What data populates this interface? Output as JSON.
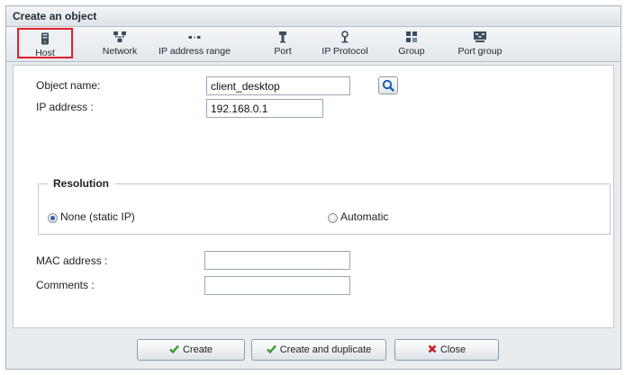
{
  "dialog": {
    "title": "Create an object"
  },
  "toolbar": {
    "items": [
      {
        "label": "Host",
        "icon": "host-icon",
        "selected": true
      },
      {
        "label": "Network",
        "icon": "network-icon"
      },
      {
        "label": "IP address range",
        "icon": "ip-range-icon"
      },
      {
        "label": "Port",
        "icon": "port-icon"
      },
      {
        "label": "IP Protocol",
        "icon": "ip-protocol-icon"
      },
      {
        "label": "Group",
        "icon": "group-icon"
      },
      {
        "label": "Port group",
        "icon": "port-group-icon"
      }
    ]
  },
  "form": {
    "object_name": {
      "label": "Object name:",
      "value": "client_desktop"
    },
    "ip_address": {
      "label": "IP address :",
      "value": "192.168.0.1"
    },
    "resolution": {
      "legend": "Resolution",
      "options": [
        {
          "label": "None (static IP)",
          "checked": true
        },
        {
          "label": "Automatic",
          "checked": false
        }
      ]
    },
    "mac_address": {
      "label": "MAC address :",
      "value": ""
    },
    "comments": {
      "label": "Comments :",
      "value": ""
    }
  },
  "footer": {
    "create_label": "Create",
    "create_dup_label": "Create and duplicate",
    "close_label": "Close"
  },
  "colors": {
    "selected_border": "#e0202a",
    "check_green": "#3a9a2a",
    "close_red": "#cc1d1d",
    "radio_dot": "#2d5fa6"
  }
}
